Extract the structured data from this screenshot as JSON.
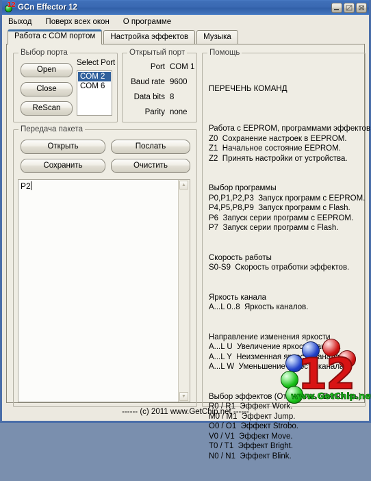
{
  "window": {
    "title": "GCn Effector 12",
    "icon": "app-logo-icon",
    "buttons": {
      "minimize": "minimize",
      "maximize": "maximize",
      "close": "close"
    }
  },
  "menu": [
    {
      "label": "Выход",
      "name": "menu-exit"
    },
    {
      "label": "Поверх всех окон",
      "name": "menu-always-on-top"
    },
    {
      "label": "О программе",
      "name": "menu-about"
    }
  ],
  "tabs": [
    {
      "label": "Работа с COM портом",
      "active": true
    },
    {
      "label": "Настройка эффектов",
      "active": false
    },
    {
      "label": "Музыка",
      "active": false
    }
  ],
  "port_select": {
    "legend": "Выбор порта",
    "buttons": [
      {
        "label": "Open"
      },
      {
        "label": "Close"
      },
      {
        "label": "ReScan"
      }
    ],
    "list_label": "Select Port",
    "ports": [
      {
        "label": "COM 2",
        "selected": true
      },
      {
        "label": "COM 6",
        "selected": false
      }
    ]
  },
  "open_port": {
    "legend": "Открытый порт",
    "rows": [
      {
        "label": "Port",
        "value": "COM 1"
      },
      {
        "label": "Baud rate",
        "value": "9600"
      },
      {
        "label": "Data bits",
        "value": "8"
      },
      {
        "label": "Parity",
        "value": "none"
      }
    ]
  },
  "packet": {
    "legend": "Передача пакета",
    "buttons": [
      {
        "label": "Открыть"
      },
      {
        "label": "Послать"
      },
      {
        "label": "Сохранить"
      },
      {
        "label": "Очистить"
      }
    ],
    "editor_value": "P2"
  },
  "help": {
    "legend": "Помощь",
    "title": "ПЕРЕЧЕНЬ КОМАНД",
    "lines": [
      "",
      "Работа с EEPROM, программами эффектов",
      "Z0  Сохранение настроек в EEPROM.",
      "Z1  Начальное состояние EEPROM.",
      "Z2  Принять настройки от устройства.",
      "",
      "",
      "Выбор программы",
      "P0,P1,P2,P3  Запуск программ с EEPROM.",
      "P4,P5,P8,P9  Запуск программ с Flash.",
      "P6  Запуск серии программ с EEPROM.",
      "P7  Запуск серии программ с Flash.",
      "",
      "",
      "Скорость работы",
      "S0-S9  Скорость отработки эффектов.",
      "",
      "",
      "Яркость канала",
      "A...L 0..8  Яркость каналов.",
      "",
      "",
      "Направление изменения яркости",
      "A...L U  Увеличение яркости канала.",
      "A...L Y  Неизменная яркость канала.",
      "A...L W  Уменьшение яркости канала.",
      "",
      "",
      "Выбор эффектов (Отключить / Включить)",
      "R0 / R1  Эффект Work.",
      "M0 / M1  Эффект Jump.",
      "O0 / O1  Эффект Strobo.",
      "V0 / V1  Эффект Move.",
      "T0 / T1  Эффект Bright.",
      "N0 / N1  Эффект Blink."
    ],
    "logo": {
      "number": "12",
      "site": "www.GetChip.net"
    }
  },
  "status": {
    "text": "------  (c) 2011  www.GetChip.net  ------"
  },
  "colors": {
    "titlebar": "#3a69b2",
    "window_frame": "#4a6ea9",
    "panel_bg": "#efede4",
    "selection": "#31619c",
    "tab_accent": "#3a6ea5",
    "logo_red": "#d81414",
    "logo_green": "#22c022"
  }
}
